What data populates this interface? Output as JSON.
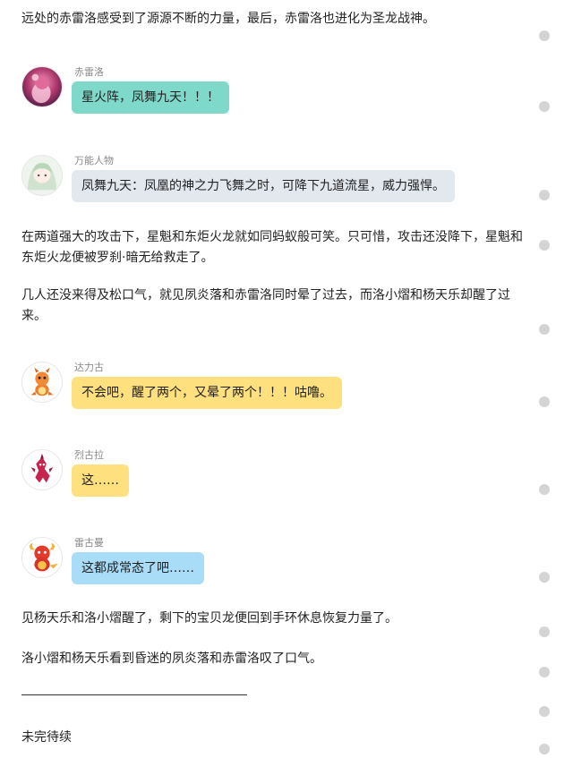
{
  "content": {
    "p1": "远处的赤雷洛感受到了源源不断的力量，最后，赤雷洛也进化为圣龙战神。",
    "msg1": {
      "sender": "赤雷洛",
      "text": "星火阵，凤舞九天！！！",
      "color": "#7ed9ca"
    },
    "msg2": {
      "sender": "万能人物",
      "text": "凤舞九天：凤凰的神之力飞舞之时，可降下九道流星，威力强悍。",
      "color": "#e3e8ef"
    },
    "p2": "在两道强大的攻击下，星魁和东炬火龙就如同蚂蚁般可笑。只可惜，攻击还没降下，星魁和东炬火龙便被罗刹·暗无给救走了。",
    "p3": "几人还没来得及松口气，就见夙炎落和赤雷洛同时晕了过去，而洛小熠和杨天乐却醒了过来。",
    "msg3": {
      "sender": "达力古",
      "text": "不会吧，醒了两个，又晕了两个！！！咕噜。",
      "color": "#ffe07f"
    },
    "msg4": {
      "sender": "烈古拉",
      "text": "这……",
      "color": "#ffe07f"
    },
    "msg5": {
      "sender": "雷古曼",
      "text": "这都成常态了吧……",
      "color": "#a9dcf7"
    },
    "p4": "见杨天乐和洛小熠醒了，剩下的宝贝龙便回到手环休息恢复力量了。",
    "p5": "洛小熠和杨天乐看到昏迷的夙炎落和赤雷洛叹了口气。",
    "p6": "未完待续"
  }
}
